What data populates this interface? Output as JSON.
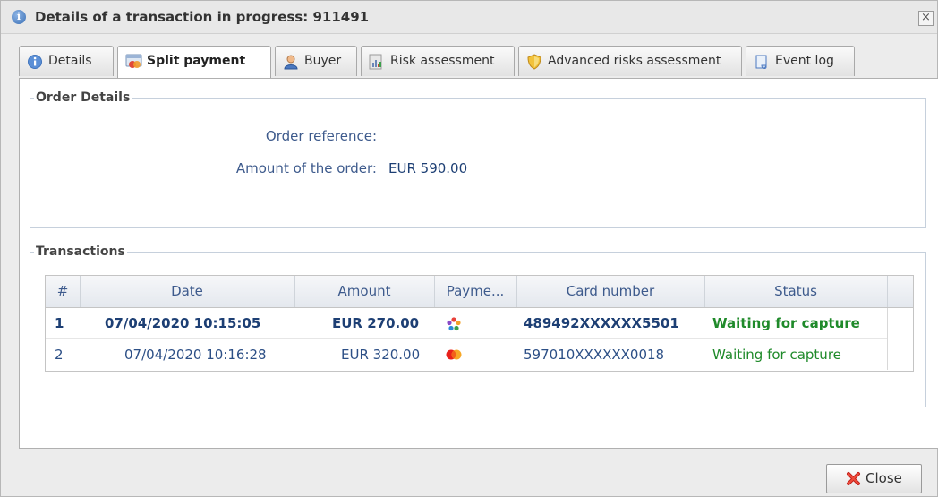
{
  "window": {
    "title": "Details of a transaction in progress: 911491",
    "close_glyph": "×"
  },
  "tabs": [
    {
      "label": "Details",
      "icon": "info-icon",
      "active": false
    },
    {
      "label": "Split payment",
      "icon": "split-payment-icon",
      "active": true
    },
    {
      "label": "Buyer",
      "icon": "buyer-icon",
      "active": false
    },
    {
      "label": "Risk assessment",
      "icon": "risk-chart-icon",
      "active": false
    },
    {
      "label": "Advanced risks assessment",
      "icon": "shield-icon",
      "active": false
    },
    {
      "label": "Event log",
      "icon": "scroll-icon",
      "active": false
    }
  ],
  "order_details": {
    "legend": "Order Details",
    "reference_label": "Order reference:",
    "reference_value": "",
    "amount_label": "Amount of the order:",
    "amount_value": "EUR 590.00"
  },
  "transactions": {
    "legend": "Transactions",
    "columns": [
      "#",
      "Date",
      "Amount",
      "Payme...",
      "Card number",
      "Status"
    ],
    "rows": [
      {
        "num": "1",
        "date": "07/04/2020 10:15:05",
        "amount": "EUR 270.00",
        "payment_icon": "wallet-flower-icon",
        "card": "489492XXXXXX5501",
        "status": "Waiting for capture",
        "bold": true
      },
      {
        "num": "2",
        "date": "07/04/2020 10:16:28",
        "amount": "EUR 320.00",
        "payment_icon": "mastercard-icon",
        "card": "597010XXXXXX0018",
        "status": "Waiting for capture",
        "bold": false
      }
    ]
  },
  "footer": {
    "close_label": "Close"
  },
  "colors": {
    "status_green": "#1f8a2a",
    "label_blue": "#3d5a8c",
    "value_blue": "#1d3f74"
  }
}
